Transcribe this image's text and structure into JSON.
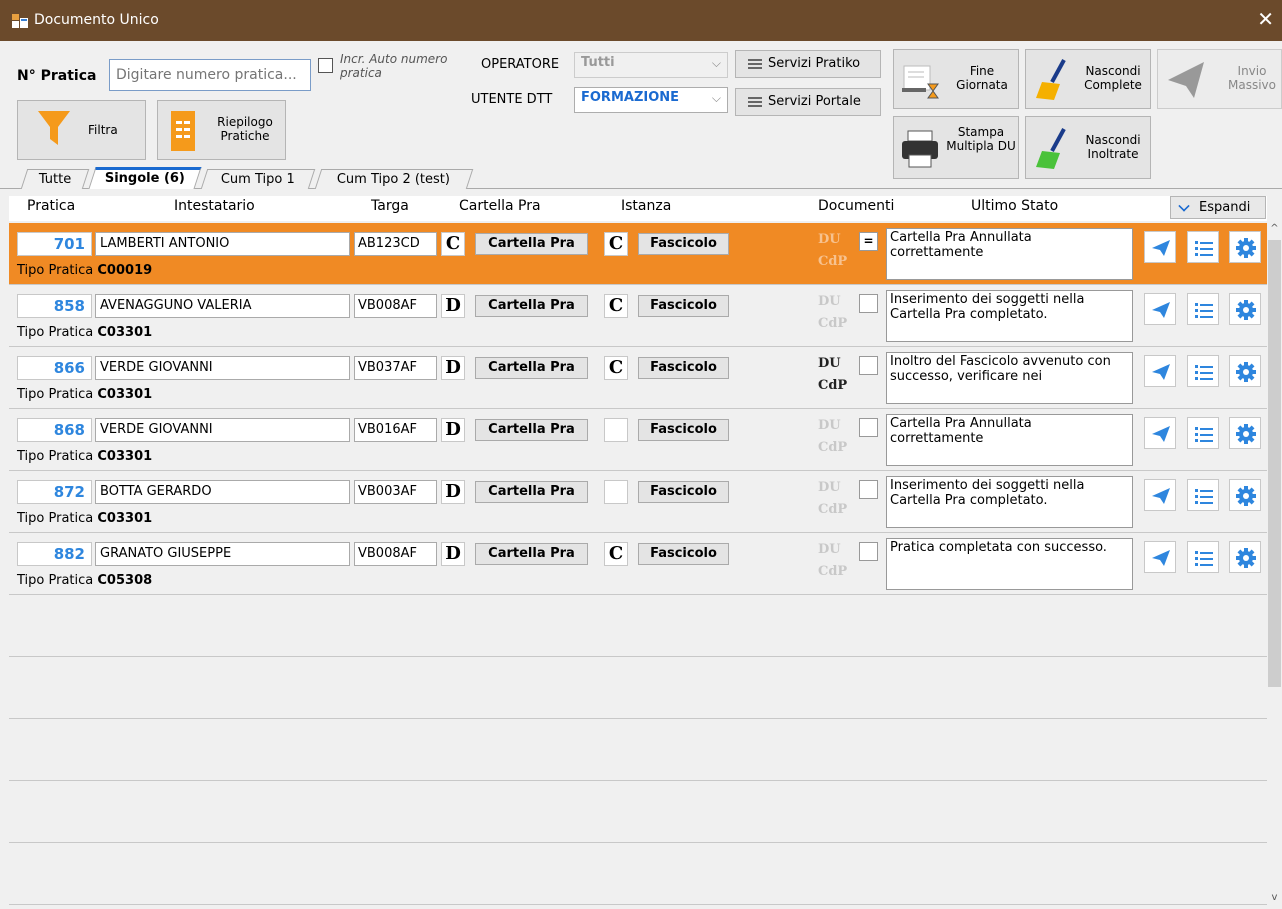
{
  "window": {
    "title": "Documento Unico"
  },
  "toolbar": {
    "pratica_label": "N° Pratica",
    "pratica_placeholder": "Digitare numero pratica...",
    "incr_label": "Incr. Auto numero pratica",
    "operatore_label": "OPERATORE",
    "operatore_value": "Tutti",
    "utente_label": "UTENTE DTT",
    "utente_value": "FORMAZIONE",
    "servizi_pratiko": "Servizi Pratiko",
    "servizi_portale": "Servizi Portale",
    "filtra": "Filtra",
    "riepilogo": "Riepilogo Pratiche",
    "fine_giornata": "Fine Giornata",
    "nascondi_complete": "Nascondi Complete",
    "invio_massivo": "Invio Massivo",
    "stampa_multipla": "Stampa Multipla DU",
    "nascondi_inoltrate": "Nascondi Inoltrate"
  },
  "tabs": [
    "Tutte",
    "Singole (6)",
    "Cum Tipo 1",
    "Cum Tipo 2 (test)"
  ],
  "columns": {
    "pratica": "Pratica",
    "intestatario": "Intestatario",
    "targa": "Targa",
    "cartella": "Cartella Pra",
    "istanza": "Istanza",
    "documenti": "Documenti",
    "ultimo_stato": "Ultimo Stato",
    "espandi": "Espandi"
  },
  "labels": {
    "cartella_btn": "Cartella Pra",
    "fascicolo_btn": "Fascicolo",
    "tipo_pratica": "Tipo Pratica",
    "du": "DU",
    "cdp": "CdP"
  },
  "rows": [
    {
      "num": "701",
      "name": "LAMBERTI ANTONIO",
      "plate": "AB123CD",
      "cart_letter": "C",
      "ist_letter": "C",
      "tipo": "C00019",
      "doc_mark": "=",
      "status": "Cartella Pra Annullata correttamente"
    },
    {
      "num": "858",
      "name": "AVENAGGUNO VALERIA",
      "plate": "VB008AF",
      "cart_letter": "D",
      "ist_letter": "C",
      "tipo": "C03301",
      "doc_mark": "",
      "status": "Inserimento dei soggetti nella Cartella Pra completato."
    },
    {
      "num": "866",
      "name": "VERDE GIOVANNI",
      "plate": "VB037AF",
      "cart_letter": "D",
      "ist_letter": "C",
      "tipo": "C03301",
      "doc_mark": "",
      "status": "Inoltro del Fascicolo avvenuto con successo, verificare nei"
    },
    {
      "num": "868",
      "name": "VERDE GIOVANNI",
      "plate": "VB016AF",
      "cart_letter": "D",
      "ist_letter": "",
      "tipo": "C03301",
      "doc_mark": "",
      "status": "Cartella Pra Annullata correttamente"
    },
    {
      "num": "872",
      "name": "BOTTA GERARDO",
      "plate": "VB003AF",
      "cart_letter": "D",
      "ist_letter": "",
      "tipo": "C03301",
      "doc_mark": "",
      "status": "Inserimento dei soggetti nella Cartella Pra completato."
    },
    {
      "num": "882",
      "name": "GRANATO GIUSEPPE",
      "plate": "VB008AF",
      "cart_letter": "D",
      "ist_letter": "C",
      "tipo": "C05308",
      "doc_mark": "",
      "status": "Pratica completata con successo."
    }
  ]
}
